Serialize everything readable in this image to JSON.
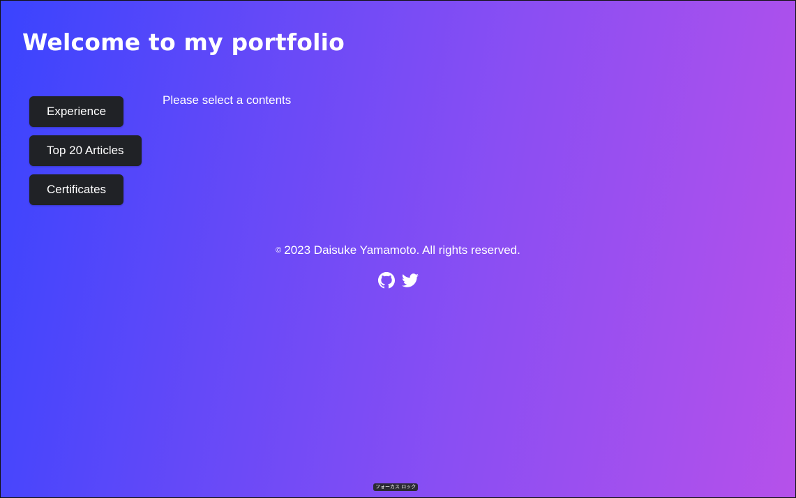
{
  "header": {
    "title": "Welcome to my portfolio"
  },
  "nav": {
    "items": [
      {
        "label": "Experience"
      },
      {
        "label": "Top 20 Articles"
      },
      {
        "label": "Certificates"
      }
    ]
  },
  "main": {
    "placeholder": "Please select a contents"
  },
  "footer": {
    "copyright_symbol": "©",
    "copyright_text": "2023 Daisuke Yamamoto. All rights reserved.",
    "social_links": [
      {
        "icon": "github-icon"
      },
      {
        "icon": "twitter-icon"
      }
    ]
  },
  "system": {
    "focus_lock_label": "フォーカス ロック"
  },
  "colors": {
    "gradient_start": "#3a44fe",
    "gradient_end": "#b651ea",
    "button_background": "#202226",
    "text": "#ffffff"
  }
}
